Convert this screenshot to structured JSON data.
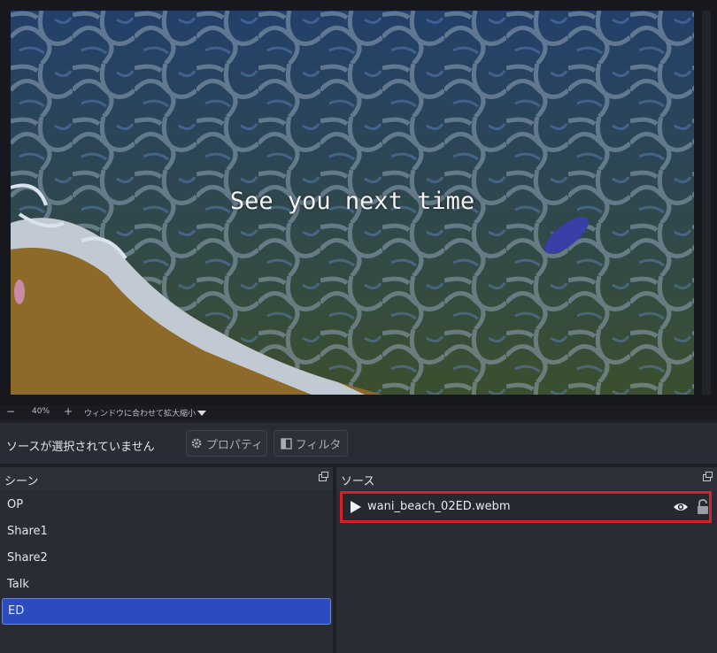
{
  "preview": {
    "overlay_text": "See you next time"
  },
  "zoombar": {
    "minus": "−",
    "zoom_level": "40%",
    "plus": "+",
    "fit_label": "ウィンドウに合わせて拡大縮小"
  },
  "toolbar": {
    "no_source_label": "ソースが選択されていません",
    "properties_label": "プロパティ",
    "filters_label": "フィルタ"
  },
  "scenes": {
    "title": "シーン",
    "items": [
      {
        "label": "OP"
      },
      {
        "label": "Share1"
      },
      {
        "label": "Share2"
      },
      {
        "label": "Talk"
      },
      {
        "label": "ED",
        "active": true
      }
    ]
  },
  "sources": {
    "title": "ソース",
    "items": [
      {
        "label": "wani_beach_02ED.webm",
        "visible": true,
        "locked": false,
        "icon": "play-icon"
      }
    ]
  },
  "colors": {
    "accent": "#2b4cbf",
    "highlight_border": "#d8202c"
  }
}
